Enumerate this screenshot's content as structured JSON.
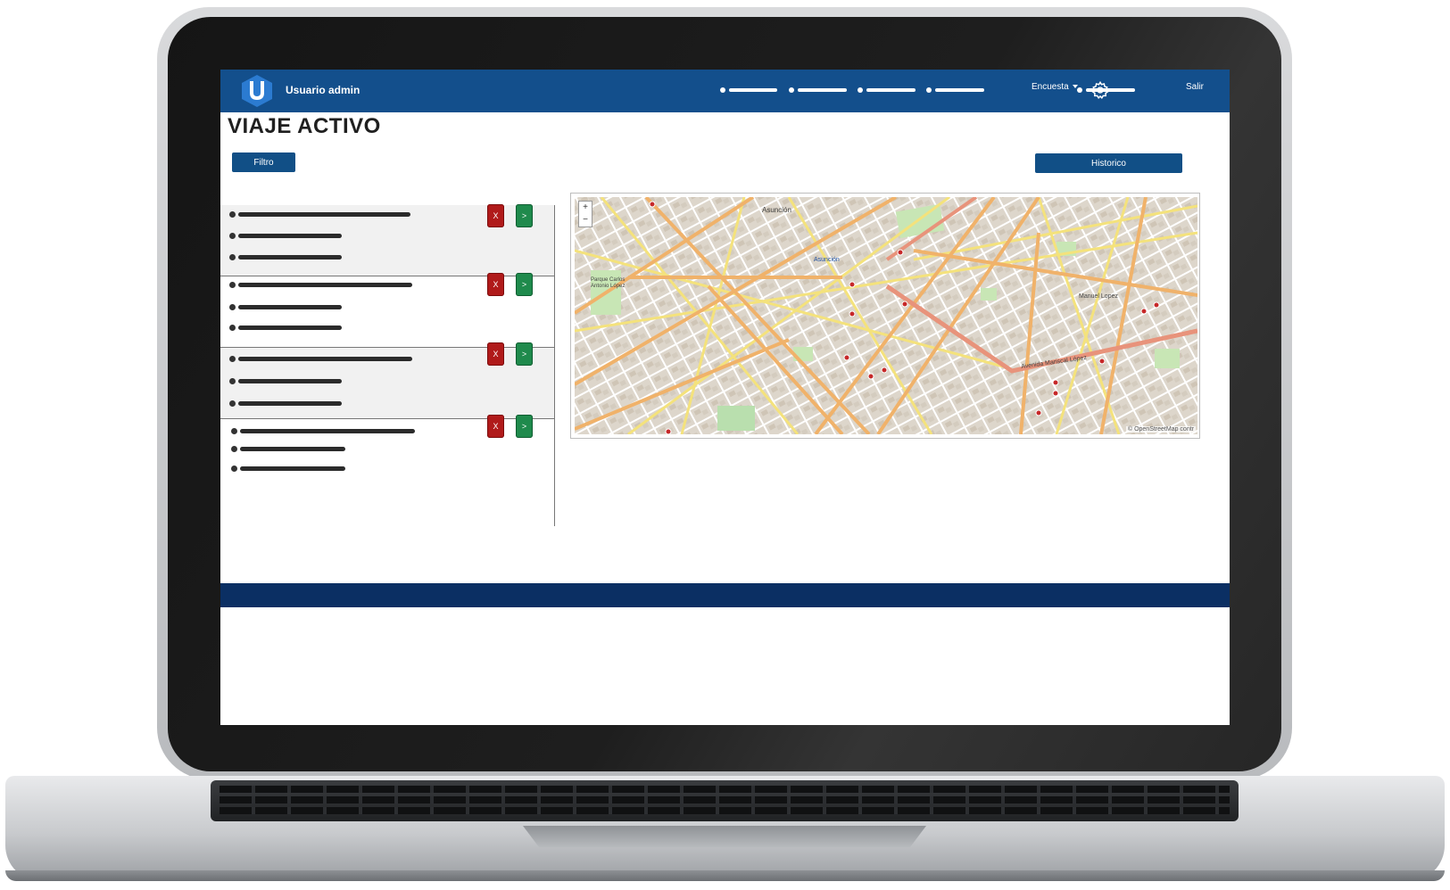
{
  "header": {
    "brand": "Usuario admin",
    "dropdown_label": "Encuesta",
    "logout_label": "Salir"
  },
  "page": {
    "title": "VIAJE ACTIVO",
    "filter_label": "Filtro",
    "history_label": "Historico"
  },
  "trips": {
    "cancel_label": "X",
    "open_label": ">"
  },
  "map": {
    "label_asuncion": "Asunción",
    "label_asuncion_center": "Asunción",
    "label_park": "Parque Carlos Antonio López",
    "label_avenue": "Avenida Mariscal López",
    "label_manuel": "Manuel Lopez",
    "attribution": "© OpenStreetMap contr",
    "zoom_in": "+",
    "zoom_out": "−"
  },
  "colors": {
    "navbar": "#134f8c",
    "footer": "#0b2f63",
    "primary_button": "#114f86",
    "cancel_button": "#b01a1a",
    "open_button": "#1f8a4c",
    "map_marker": "#c62828"
  }
}
